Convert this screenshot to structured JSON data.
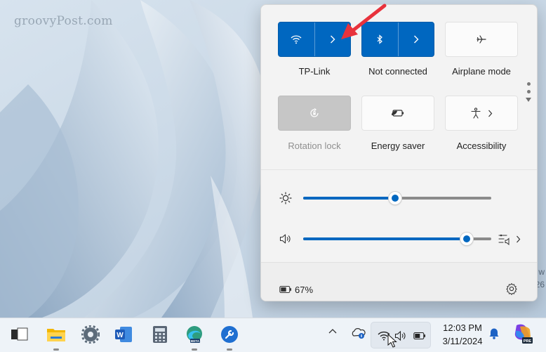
{
  "wallpaper": {
    "watermark": "groovyPost.com",
    "edge_text_1": "w",
    "edge_text_2": "26"
  },
  "quick_settings": {
    "tiles": [
      {
        "id": "wifi",
        "label": "TP-Link",
        "state": "on",
        "icon": "wifi-icon",
        "has_arrow": true
      },
      {
        "id": "bluetooth",
        "label": "Not connected",
        "state": "on",
        "icon": "bluetooth-icon",
        "has_arrow": true
      },
      {
        "id": "airplane",
        "label": "Airplane mode",
        "state": "off",
        "icon": "airplane-icon"
      },
      {
        "id": "rotation",
        "label": "Rotation lock",
        "state": "disabled",
        "icon": "rotation-lock-icon"
      },
      {
        "id": "energy",
        "label": "Energy saver",
        "state": "off",
        "icon": "energy-saver-icon"
      },
      {
        "id": "accessibility",
        "label": "Accessibility",
        "state": "off",
        "icon": "accessibility-icon",
        "has_arrow": true
      }
    ],
    "brightness": {
      "value": 0.49,
      "icon": "sun-icon"
    },
    "volume": {
      "value": 0.87,
      "icon": "speaker-icon"
    },
    "battery": {
      "percent_text": "67%",
      "level": 0.67,
      "icon": "battery-icon"
    }
  },
  "taskbar": {
    "clock": {
      "time": "12:03 PM",
      "date": "3/11/2024"
    },
    "apps": [
      "task-view",
      "file-explorer",
      "settings",
      "word",
      "calculator",
      "edge-beta",
      "settings-tools"
    ],
    "tray_icons": [
      "chevron-up-icon",
      "onedrive-icon",
      "wifi-icon",
      "speaker-icon",
      "battery-icon",
      "bell-icon",
      "copilot-icon"
    ]
  },
  "colors": {
    "accent": "#0067c0",
    "panel_bg": "#f3f3f3",
    "annotation_arrow": "#e8323c"
  }
}
